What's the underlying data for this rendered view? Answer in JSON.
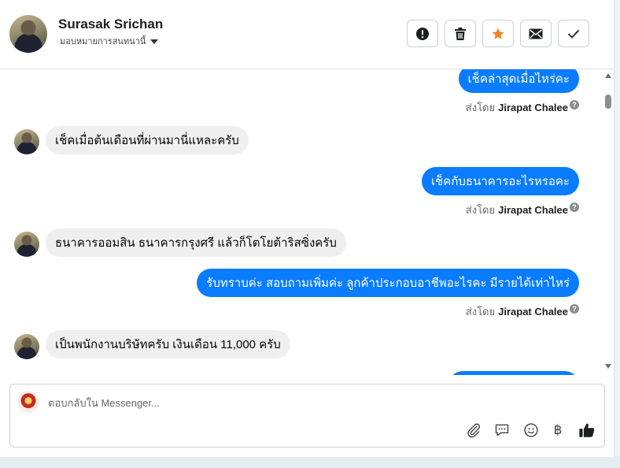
{
  "header": {
    "user_name": "Surasak Srichan",
    "assign_label": "มอบหมายการสนทนานี้",
    "actions": [
      {
        "name": "report",
        "icon": "exclamation-circle-icon"
      },
      {
        "name": "delete",
        "icon": "trash-icon"
      },
      {
        "name": "star",
        "icon": "star-icon",
        "color": "#f5821f"
      },
      {
        "name": "mark-unread",
        "icon": "envelope-icon"
      },
      {
        "name": "done",
        "icon": "check-icon"
      }
    ]
  },
  "messages": {
    "out_1": "เช็คล่าสุดเมื่อไหร่คะ",
    "in_1": "เช็คเมื่อต้นเดือนที่ผ่านมานี่แหละครับ",
    "out_2": "เช็คกับธนาคารอะไรหรอคะ",
    "in_2": "ธนาคารออมสิน ธนาคารกรุงศรี แล้วก็โตโยต้าริสซิ่งครับ",
    "out_3": "รับทราบค่ะ สอบถามเพิ่มค่ะ ลูกค้าประกอบอาชีพอะไรคะ มีรายได้เท่าไหร่",
    "in_3": "เป็นพนักงานบริษัทครับ เงินเดือน 11,000 ครับ",
    "sent_by_prefix": "ส่งโดย",
    "sender_name": "Jirapat Chalee",
    "help_glyph": "?"
  },
  "reply": {
    "placeholder": "ตอบกลับใน Messenger...",
    "tools": [
      "paperclip-icon",
      "speech-bubble-icon",
      "smiley-icon",
      "baht-icon",
      "thumbs-up-icon"
    ],
    "baht_glyph": "฿"
  },
  "colors": {
    "outgoing_bubble": "#0a7cff",
    "incoming_bubble": "#efefef",
    "star": "#f5821f"
  }
}
